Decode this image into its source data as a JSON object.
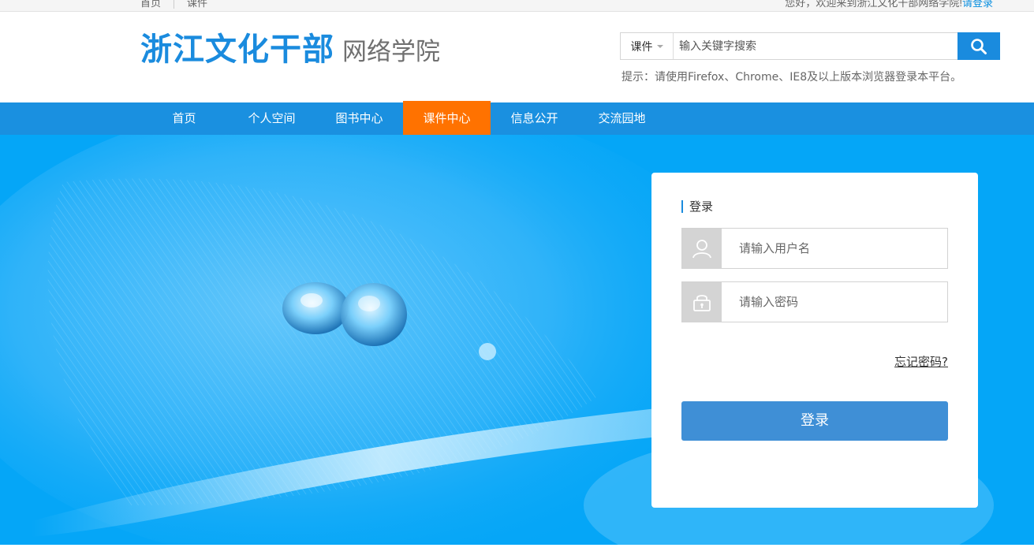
{
  "topbar": {
    "links": [
      "首页",
      "课件"
    ],
    "greeting": "您好，欢迎来到浙江文化干部网络学院!",
    "login_link": "请登录"
  },
  "header": {
    "logo_main": "浙江文化干部",
    "logo_sub": "网络学院",
    "search": {
      "scope": "课件",
      "placeholder": "输入关键字搜索",
      "button_icon": "search-icon"
    },
    "tip": "提示：请使用Firefox、Chrome、IE8及以上版本浏览器登录本平台。"
  },
  "nav": {
    "items": [
      "首页",
      "个人空间",
      "图书中心",
      "课件中心",
      "信息公开",
      "交流园地"
    ],
    "active": "课件中心"
  },
  "login": {
    "title": "登录",
    "username_placeholder": "请输入用户名",
    "password_placeholder": "请输入密码",
    "forgot": "忘记密码?",
    "submit": "登录",
    "icons": [
      "user-icon",
      "lock-icon"
    ]
  },
  "colors": {
    "brand_blue": "#1a8bde",
    "nav_active": "#ff7200",
    "banner_blue": "#05a6f7",
    "submit_blue": "#3f8fd6"
  }
}
